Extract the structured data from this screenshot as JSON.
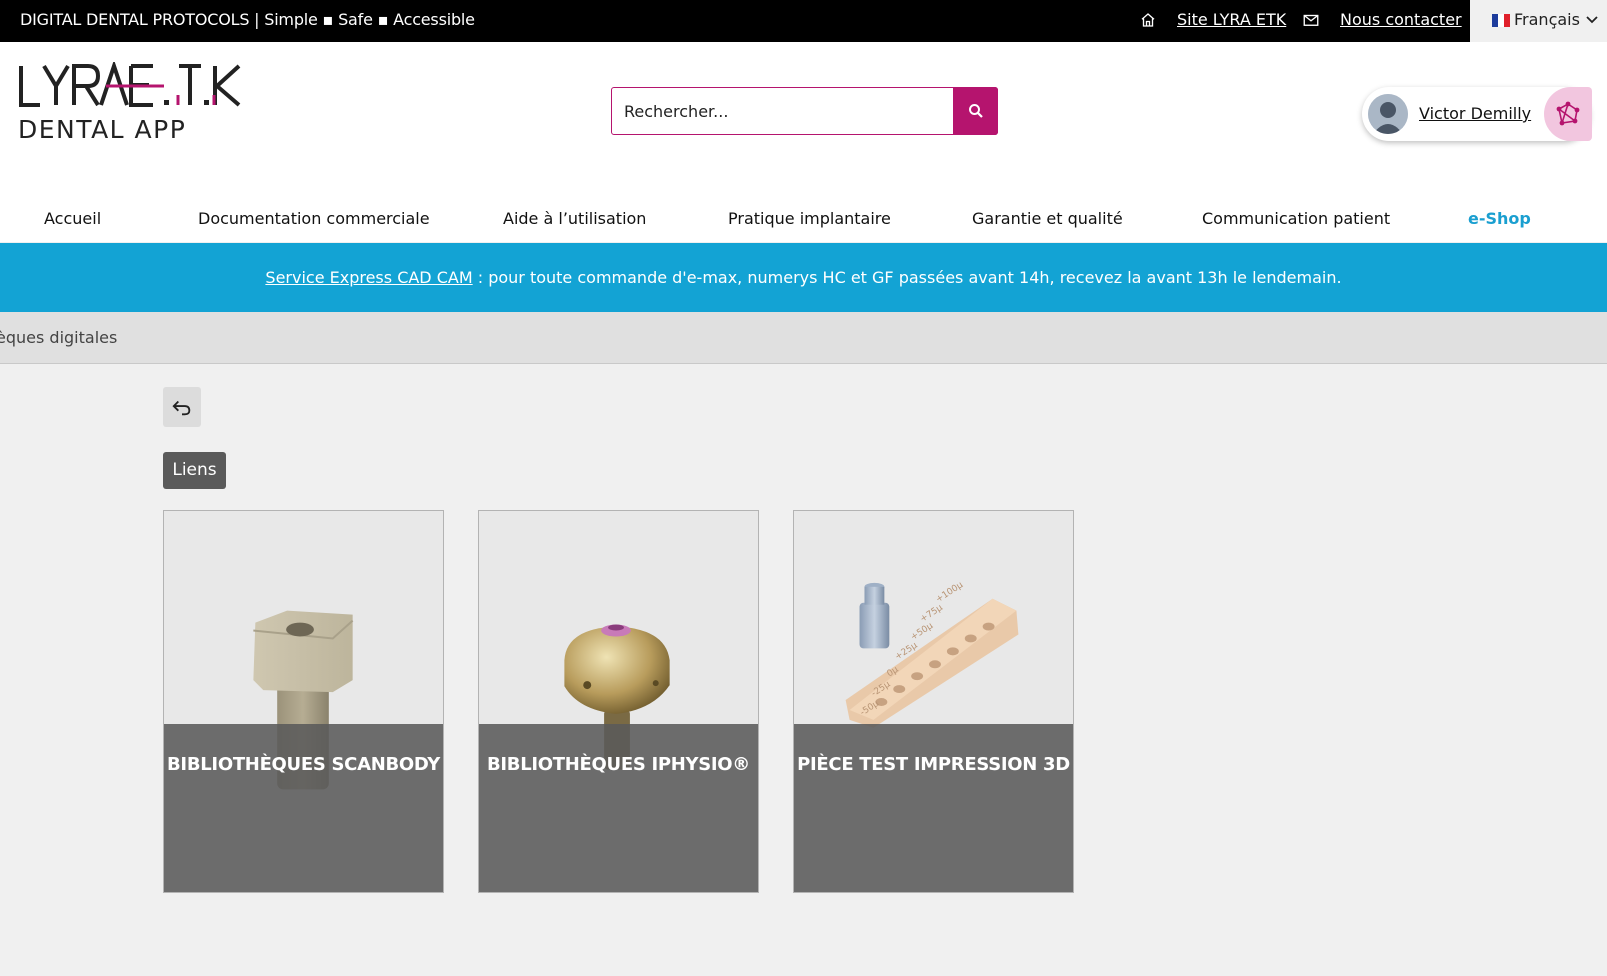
{
  "topbar": {
    "tagline": "DIGITAL DENTAL PROTOCOLS | Simple ▪ Safe ▪ Accessible",
    "site_link": "Site LYRA ETK",
    "contact_link": "Nous contacter",
    "language": "Français"
  },
  "header": {
    "logo_main": "LYRA-E.T.K",
    "logo_sub": "DENTAL APP",
    "search_placeholder": "Rechercher...",
    "user_name": "Victor Demilly"
  },
  "nav": {
    "items": [
      "Accueil",
      "Documentation commerciale",
      "Aide à l’utilisation",
      "Pratique implantaire",
      "Garantie et qualité",
      "Communication patient",
      "e-Shop"
    ]
  },
  "banner": {
    "link": "Service Express CAD CAM",
    "text": " : pour toute commande d'e-max, numerys HC et GF passées avant 14h, recevez la avant 13h le lendemain."
  },
  "breadcrumb": "èques digitales",
  "tag": "Liens",
  "cards": [
    {
      "title": "BIBLIOTHÈQUES SCANBODY"
    },
    {
      "title": "BIBLIOTHÈQUES IPHYSIO®"
    },
    {
      "title": "PIÈCE TEST IMPRESSION 3D"
    }
  ],
  "test_piece_marks": [
    "+100µ",
    "+75µ",
    "+50µ",
    "+25µ",
    "0µ",
    "-25µ",
    "-50µ"
  ],
  "colors": {
    "brand_magenta": "#b5146e",
    "banner_blue": "#13a3d4",
    "shop_blue": "#1a9fd0"
  }
}
